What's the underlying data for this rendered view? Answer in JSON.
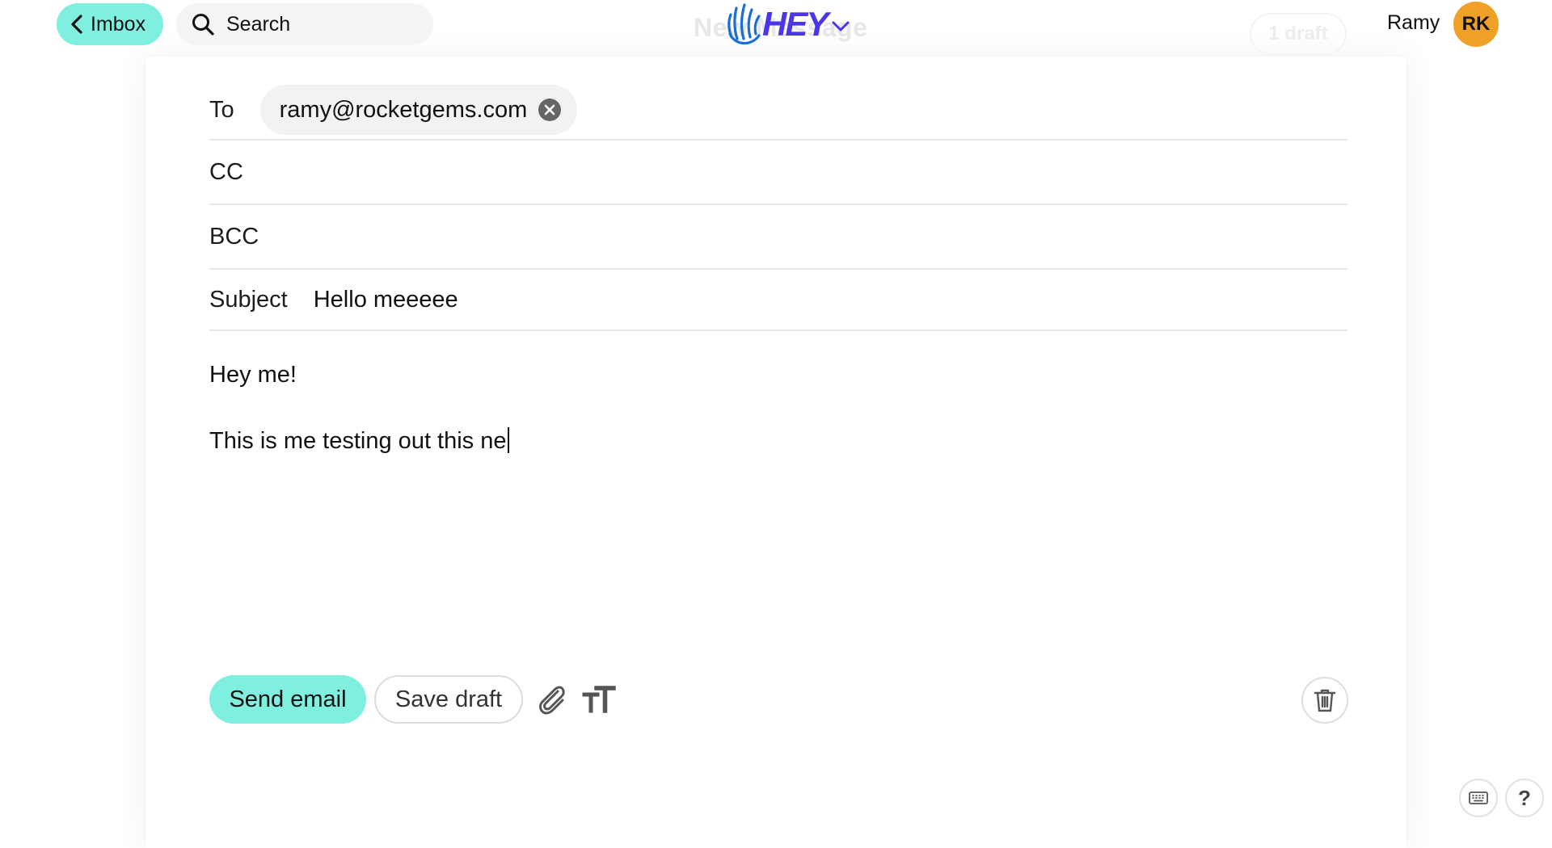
{
  "header": {
    "back_label": "Imbox",
    "search_label": "Search",
    "faded_title": "New Message",
    "logo_text": "HEY",
    "draft_count_label": "1 draft",
    "user_name": "Ramy",
    "avatar_initials": "RK"
  },
  "compose": {
    "to_label": "To",
    "to_recipient": "ramy@rocketgems.com",
    "cc_label": "CC",
    "bcc_label": "BCC",
    "subject_label": "Subject",
    "subject_value": "Hello meeeee",
    "body_line_1": "Hey me!",
    "body_line_2": "This is me testing out this ne"
  },
  "toolbar": {
    "send_label": "Send email",
    "save_label": "Save draft",
    "help_label": "?"
  },
  "colors": {
    "accent": "#7ff0e0",
    "brand": "#4a36e8",
    "avatar_bg": "#eea126"
  },
  "icons": [
    "back-chevron-icon",
    "search-icon",
    "hey-hand-icon",
    "chevron-down-icon",
    "remove-recipient-icon",
    "paperclip-icon",
    "text-format-icon",
    "trash-icon",
    "keyboard-icon"
  ]
}
